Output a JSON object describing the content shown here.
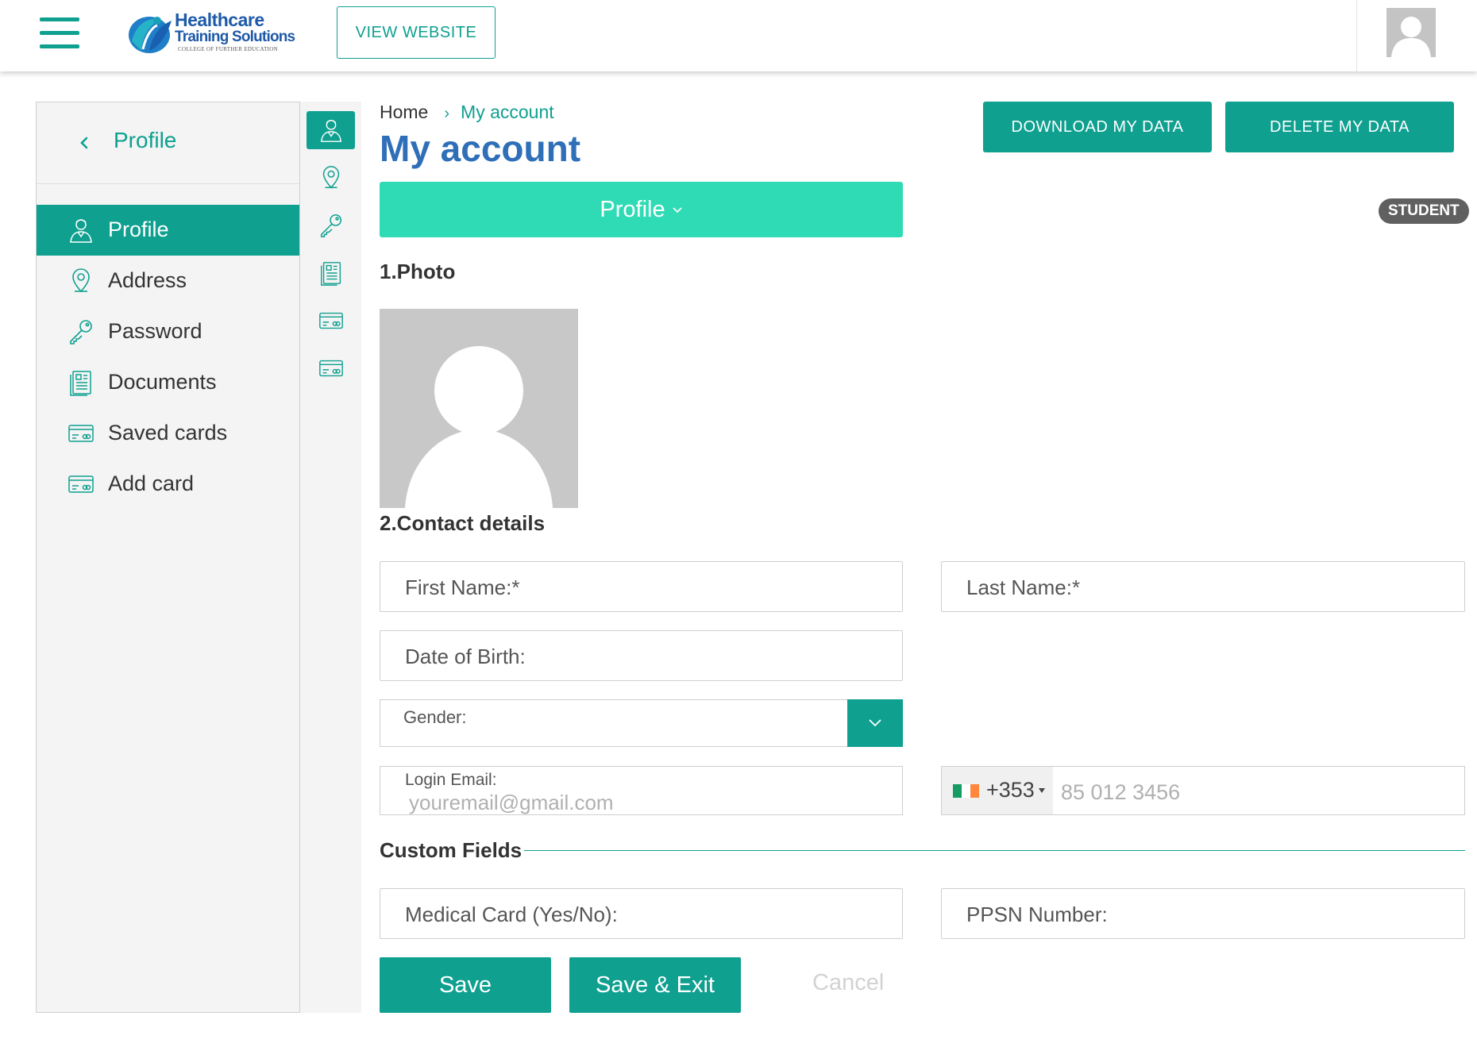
{
  "header": {
    "logo": {
      "line1": "Healthcare",
      "line2": "Training Solutions",
      "line3": "COLLEGE OF FURTHER EDUCATION"
    },
    "view_website_label": "VIEW WEBSITE",
    "menu_icon": "hamburger-icon",
    "avatar_icon": "user-avatar-icon"
  },
  "sidebar": {
    "back_icon": "chevron-left-icon",
    "title": "Profile",
    "items": [
      {
        "label": "Profile",
        "icon": "user-icon",
        "active": true
      },
      {
        "label": "Address",
        "icon": "map-pin-icon",
        "active": false
      },
      {
        "label": "Password",
        "icon": "key-icon",
        "active": false
      },
      {
        "label": "Documents",
        "icon": "document-icon",
        "active": false
      },
      {
        "label": "Saved cards",
        "icon": "credit-card-icon",
        "active": false
      },
      {
        "label": "Add card",
        "icon": "credit-card-icon",
        "active": false
      }
    ]
  },
  "breadcrumb": {
    "home": "Home",
    "separator": "›",
    "current": "My account"
  },
  "page_title": "My account",
  "actions": {
    "download": "DOWNLOAD MY DATA",
    "delete": "DELETE MY DATA"
  },
  "profile_dropdown": {
    "label": "Profile"
  },
  "role_badge": "STUDENT",
  "sections": {
    "photo": "1.Photo",
    "contact": "2.Contact details",
    "custom": "Custom Fields"
  },
  "form": {
    "first_name": "First Name:*",
    "last_name": "Last Name:*",
    "dob": "Date of Birth:",
    "gender_label": "Gender:",
    "email_label": "Login Email:",
    "email_placeholder": "youremail@gmail.com",
    "phone_country_code": "+353",
    "phone_placeholder": "85 012 3456",
    "medical_card": "Medical Card (Yes/No):",
    "ppsn": "PPSN Number:"
  },
  "buttons": {
    "save": "Save",
    "save_exit": "Save & Exit",
    "cancel": "Cancel"
  },
  "colors": {
    "primary": "#0fa090",
    "accent_light": "#2fdbb5",
    "title_blue": "#2f6fb8",
    "badge": "#606060"
  }
}
